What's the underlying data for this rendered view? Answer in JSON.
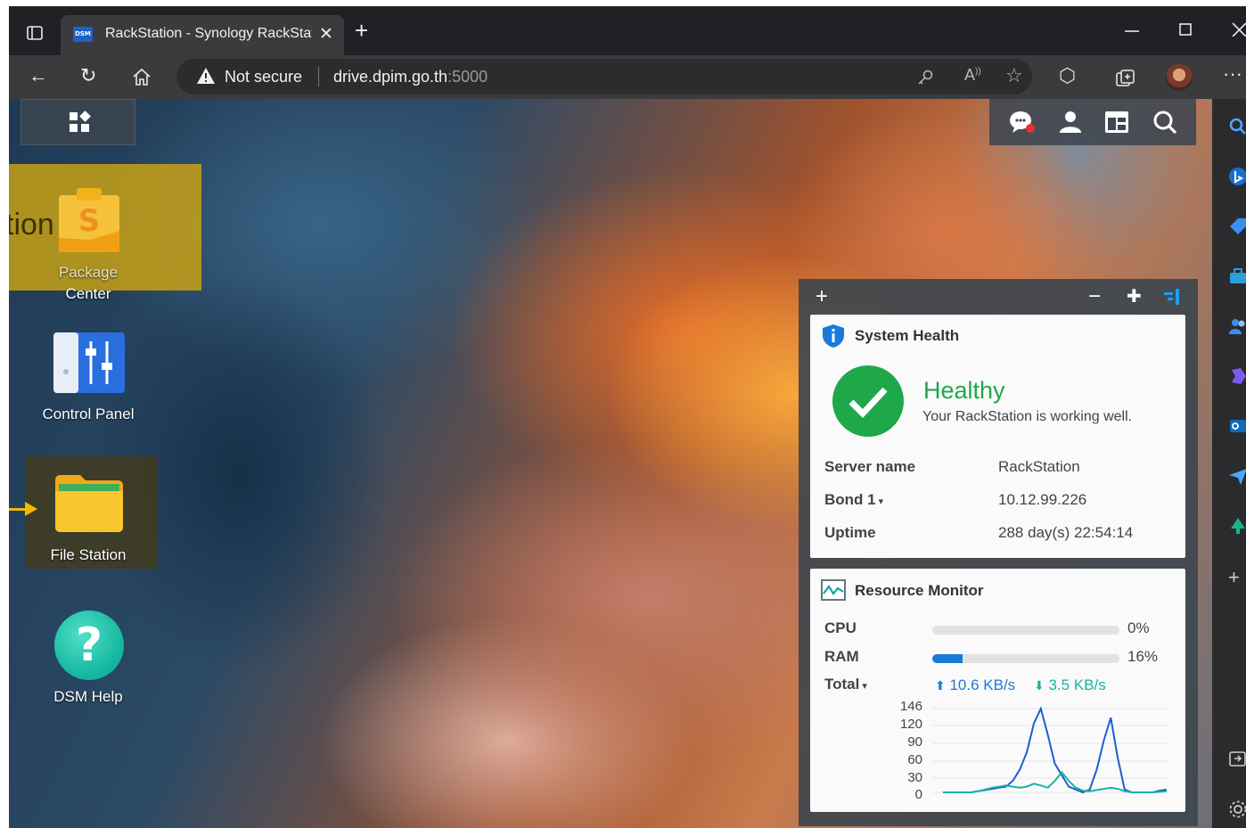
{
  "browser": {
    "tab_title": "RackStation - Synology RackStati",
    "tab_favicon_text": "DSM",
    "security_label": "Not secure",
    "url_host": "drive.dpim.go.th",
    "url_port": ":5000",
    "icons": [
      "sidebar-toggle-icon",
      "close-tab-icon",
      "new-tab-icon",
      "minimize-icon",
      "maximize-icon",
      "close-window-icon",
      "back-icon",
      "refresh-icon",
      "home-icon",
      "warning-icon",
      "key-icon",
      "read-aloud-icon",
      "add-favorite-icon",
      "extensions-icon",
      "collections-icon",
      "profile-avatar",
      "more-icon"
    ]
  },
  "desktop": {
    "highlight_label": "tion",
    "apps": [
      {
        "label_line1": "Package",
        "label_line2": "Center",
        "icon": "package-center-icon"
      },
      {
        "label": "Control Panel",
        "icon": "control-panel-icon"
      },
      {
        "label": "File Station",
        "icon": "file-station-icon"
      },
      {
        "label": "DSM Help",
        "icon": "dsm-help-icon",
        "glyph": "?"
      }
    ],
    "tray_icons": [
      "notification-icon",
      "user-icon",
      "widgets-icon",
      "search-icon"
    ]
  },
  "system_health": {
    "title": "System Health",
    "status": "Healthy",
    "message": "Your RackStation is working well.",
    "rows": [
      {
        "label": "Server name",
        "value": "RackStation"
      },
      {
        "label": "Bond 1",
        "value": "10.12.99.226"
      },
      {
        "label": "Uptime",
        "value": "288 day(s) 22:54:14"
      }
    ]
  },
  "resource_monitor": {
    "title": "Resource Monitor",
    "cpu_label": "CPU",
    "cpu_value": "0%",
    "cpu_fraction": 0,
    "ram_label": "RAM",
    "ram_value": "16%",
    "ram_fraction": 0.16,
    "total_label": "Total",
    "upload": "10.6 KB/s",
    "download": "3.5 KB/s",
    "colors": {
      "upload": "#1a5fd0",
      "download": "#19b3a6"
    }
  },
  "chart_data": {
    "type": "line",
    "yticks": [
      "146",
      "120",
      "90",
      "60",
      "30",
      "0"
    ],
    "ylim": [
      0,
      146
    ],
    "series": [
      {
        "values": [
          0,
          0,
          0,
          0,
          0,
          2,
          4,
          6,
          8,
          10,
          20,
          40,
          70,
          120,
          146,
          100,
          50,
          30,
          10,
          5,
          0,
          5,
          40,
          90,
          130,
          60,
          5,
          0,
          0,
          0,
          0,
          3,
          5
        ]
      },
      {
        "values": [
          0,
          0,
          0,
          0,
          0,
          2,
          5,
          8,
          10,
          12,
          10,
          8,
          10,
          15,
          12,
          8,
          20,
          35,
          20,
          8,
          3,
          2,
          4,
          6,
          8,
          6,
          2,
          0,
          0,
          0,
          0,
          1,
          2
        ]
      }
    ]
  },
  "edge_sidebar": {
    "icons": [
      "search-icon",
      "bing-icon",
      "tag-icon",
      "briefcase-icon",
      "people-icon",
      "copilot-icon",
      "outlook-icon",
      "send-icon",
      "tree-icon",
      "add-icon",
      "screen-share-icon",
      "settings-icon"
    ]
  }
}
